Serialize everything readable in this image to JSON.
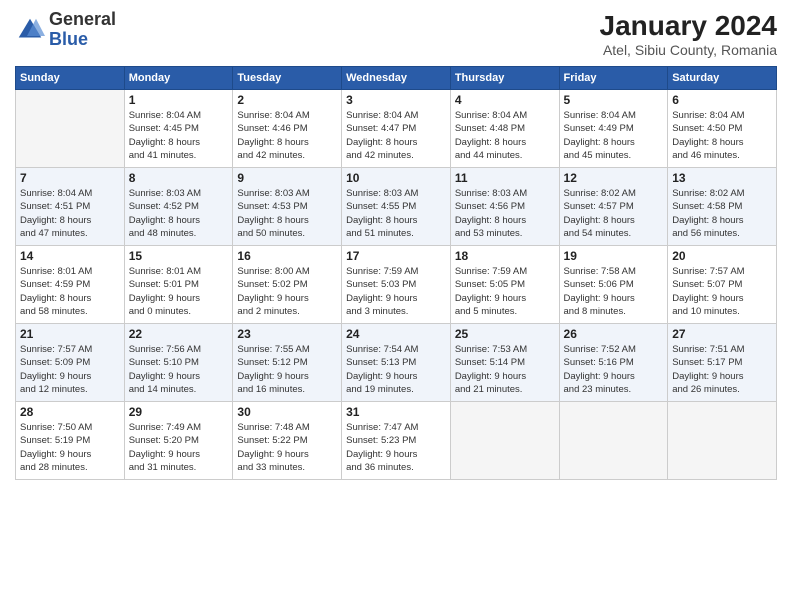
{
  "header": {
    "logo_general": "General",
    "logo_blue": "Blue",
    "month_year": "January 2024",
    "location": "Atel, Sibiu County, Romania"
  },
  "days_of_week": [
    "Sunday",
    "Monday",
    "Tuesday",
    "Wednesday",
    "Thursday",
    "Friday",
    "Saturday"
  ],
  "weeks": [
    [
      {
        "day": "",
        "info": ""
      },
      {
        "day": "1",
        "info": "Sunrise: 8:04 AM\nSunset: 4:45 PM\nDaylight: 8 hours\nand 41 minutes."
      },
      {
        "day": "2",
        "info": "Sunrise: 8:04 AM\nSunset: 4:46 PM\nDaylight: 8 hours\nand 42 minutes."
      },
      {
        "day": "3",
        "info": "Sunrise: 8:04 AM\nSunset: 4:47 PM\nDaylight: 8 hours\nand 42 minutes."
      },
      {
        "day": "4",
        "info": "Sunrise: 8:04 AM\nSunset: 4:48 PM\nDaylight: 8 hours\nand 44 minutes."
      },
      {
        "day": "5",
        "info": "Sunrise: 8:04 AM\nSunset: 4:49 PM\nDaylight: 8 hours\nand 45 minutes."
      },
      {
        "day": "6",
        "info": "Sunrise: 8:04 AM\nSunset: 4:50 PM\nDaylight: 8 hours\nand 46 minutes."
      }
    ],
    [
      {
        "day": "7",
        "info": "Sunrise: 8:04 AM\nSunset: 4:51 PM\nDaylight: 8 hours\nand 47 minutes."
      },
      {
        "day": "8",
        "info": "Sunrise: 8:03 AM\nSunset: 4:52 PM\nDaylight: 8 hours\nand 48 minutes."
      },
      {
        "day": "9",
        "info": "Sunrise: 8:03 AM\nSunset: 4:53 PM\nDaylight: 8 hours\nand 50 minutes."
      },
      {
        "day": "10",
        "info": "Sunrise: 8:03 AM\nSunset: 4:55 PM\nDaylight: 8 hours\nand 51 minutes."
      },
      {
        "day": "11",
        "info": "Sunrise: 8:03 AM\nSunset: 4:56 PM\nDaylight: 8 hours\nand 53 minutes."
      },
      {
        "day": "12",
        "info": "Sunrise: 8:02 AM\nSunset: 4:57 PM\nDaylight: 8 hours\nand 54 minutes."
      },
      {
        "day": "13",
        "info": "Sunrise: 8:02 AM\nSunset: 4:58 PM\nDaylight: 8 hours\nand 56 minutes."
      }
    ],
    [
      {
        "day": "14",
        "info": "Sunrise: 8:01 AM\nSunset: 4:59 PM\nDaylight: 8 hours\nand 58 minutes."
      },
      {
        "day": "15",
        "info": "Sunrise: 8:01 AM\nSunset: 5:01 PM\nDaylight: 9 hours\nand 0 minutes."
      },
      {
        "day": "16",
        "info": "Sunrise: 8:00 AM\nSunset: 5:02 PM\nDaylight: 9 hours\nand 2 minutes."
      },
      {
        "day": "17",
        "info": "Sunrise: 7:59 AM\nSunset: 5:03 PM\nDaylight: 9 hours\nand 3 minutes."
      },
      {
        "day": "18",
        "info": "Sunrise: 7:59 AM\nSunset: 5:05 PM\nDaylight: 9 hours\nand 5 minutes."
      },
      {
        "day": "19",
        "info": "Sunrise: 7:58 AM\nSunset: 5:06 PM\nDaylight: 9 hours\nand 8 minutes."
      },
      {
        "day": "20",
        "info": "Sunrise: 7:57 AM\nSunset: 5:07 PM\nDaylight: 9 hours\nand 10 minutes."
      }
    ],
    [
      {
        "day": "21",
        "info": "Sunrise: 7:57 AM\nSunset: 5:09 PM\nDaylight: 9 hours\nand 12 minutes."
      },
      {
        "day": "22",
        "info": "Sunrise: 7:56 AM\nSunset: 5:10 PM\nDaylight: 9 hours\nand 14 minutes."
      },
      {
        "day": "23",
        "info": "Sunrise: 7:55 AM\nSunset: 5:12 PM\nDaylight: 9 hours\nand 16 minutes."
      },
      {
        "day": "24",
        "info": "Sunrise: 7:54 AM\nSunset: 5:13 PM\nDaylight: 9 hours\nand 19 minutes."
      },
      {
        "day": "25",
        "info": "Sunrise: 7:53 AM\nSunset: 5:14 PM\nDaylight: 9 hours\nand 21 minutes."
      },
      {
        "day": "26",
        "info": "Sunrise: 7:52 AM\nSunset: 5:16 PM\nDaylight: 9 hours\nand 23 minutes."
      },
      {
        "day": "27",
        "info": "Sunrise: 7:51 AM\nSunset: 5:17 PM\nDaylight: 9 hours\nand 26 minutes."
      }
    ],
    [
      {
        "day": "28",
        "info": "Sunrise: 7:50 AM\nSunset: 5:19 PM\nDaylight: 9 hours\nand 28 minutes."
      },
      {
        "day": "29",
        "info": "Sunrise: 7:49 AM\nSunset: 5:20 PM\nDaylight: 9 hours\nand 31 minutes."
      },
      {
        "day": "30",
        "info": "Sunrise: 7:48 AM\nSunset: 5:22 PM\nDaylight: 9 hours\nand 33 minutes."
      },
      {
        "day": "31",
        "info": "Sunrise: 7:47 AM\nSunset: 5:23 PM\nDaylight: 9 hours\nand 36 minutes."
      },
      {
        "day": "",
        "info": ""
      },
      {
        "day": "",
        "info": ""
      },
      {
        "day": "",
        "info": ""
      }
    ]
  ]
}
